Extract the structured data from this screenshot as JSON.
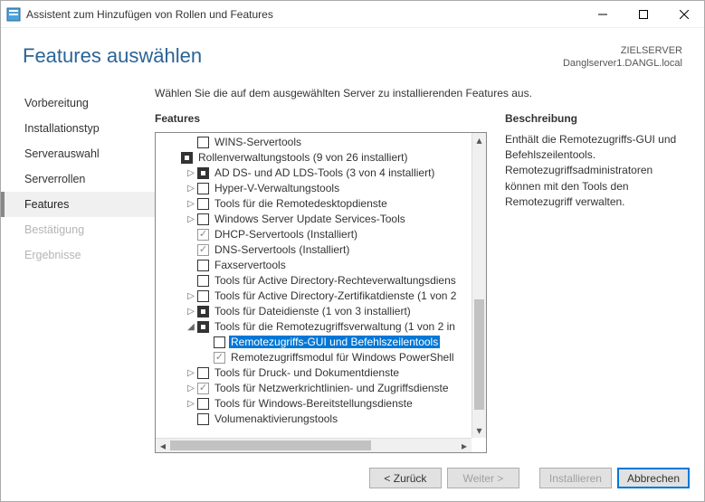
{
  "window": {
    "title": "Assistent zum Hinzufügen von Rollen und Features"
  },
  "header": {
    "title": "Features auswählen",
    "target_label": "ZIELSERVER",
    "target_value": "Danglserver1.DANGL.local"
  },
  "nav": [
    {
      "label": "Vorbereitung",
      "state": "done"
    },
    {
      "label": "Installationstyp",
      "state": "done"
    },
    {
      "label": "Serverauswahl",
      "state": "done"
    },
    {
      "label": "Serverrollen",
      "state": "done"
    },
    {
      "label": "Features",
      "state": "active"
    },
    {
      "label": "Bestätigung",
      "state": "disabled"
    },
    {
      "label": "Ergebnisse",
      "state": "disabled"
    }
  ],
  "instruction": "Wählen Sie die auf dem ausgewählten Server zu installierenden Features aus.",
  "columns": {
    "features": "Features",
    "description": "Beschreibung"
  },
  "tree": [
    {
      "indent": 1,
      "exp": "",
      "cb": "empty",
      "label": "WINS-Servertools",
      "sel": false
    },
    {
      "indent": 0,
      "exp": "",
      "cb": "tri",
      "label": "Rollenverwaltungstools (9 von 26 installiert)",
      "sel": false
    },
    {
      "indent": 1,
      "exp": "r",
      "cb": "tri",
      "label": "AD DS- und AD LDS-Tools (3 von 4 installiert)",
      "sel": false
    },
    {
      "indent": 1,
      "exp": "r",
      "cb": "empty",
      "label": "Hyper-V-Verwaltungstools",
      "sel": false
    },
    {
      "indent": 1,
      "exp": "r",
      "cb": "empty",
      "label": "Tools für die Remotedesktopdienste",
      "sel": false
    },
    {
      "indent": 1,
      "exp": "r",
      "cb": "empty",
      "label": "Windows Server Update Services-Tools",
      "sel": false
    },
    {
      "indent": 1,
      "exp": "",
      "cb": "chkdis",
      "label": "DHCP-Servertools (Installiert)",
      "sel": false
    },
    {
      "indent": 1,
      "exp": "",
      "cb": "chkdis",
      "label": "DNS-Servertools (Installiert)",
      "sel": false
    },
    {
      "indent": 1,
      "exp": "",
      "cb": "empty",
      "label": "Faxservertools",
      "sel": false
    },
    {
      "indent": 1,
      "exp": "",
      "cb": "empty",
      "label": "Tools für Active Directory-Rechteverwaltungsdiens",
      "sel": false
    },
    {
      "indent": 1,
      "exp": "r",
      "cb": "empty",
      "label": "Tools für Active Directory-Zertifikatdienste (1 von 2",
      "sel": false
    },
    {
      "indent": 1,
      "exp": "r",
      "cb": "tri",
      "label": "Tools für Dateidienste (1 von 3 installiert)",
      "sel": false
    },
    {
      "indent": 1,
      "exp": "d",
      "cb": "tri",
      "label": "Tools für die Remotezugriffsverwaltung (1 von 2 in",
      "sel": false
    },
    {
      "indent": 2,
      "exp": "",
      "cb": "empty",
      "label": "Remotezugriffs-GUI und Befehlszeilentools",
      "sel": true
    },
    {
      "indent": 2,
      "exp": "",
      "cb": "chkdis",
      "label": "Remotezugriffsmodul für Windows PowerShell",
      "sel": false
    },
    {
      "indent": 1,
      "exp": "r",
      "cb": "empty",
      "label": "Tools für Druck- und Dokumentdienste",
      "sel": false
    },
    {
      "indent": 1,
      "exp": "r",
      "cb": "chkdis",
      "label": "Tools für Netzwerkrichtlinien- und Zugriffsdienste",
      "sel": false
    },
    {
      "indent": 1,
      "exp": "r",
      "cb": "empty",
      "label": "Tools für Windows-Bereitstellungsdienste",
      "sel": false
    },
    {
      "indent": 1,
      "exp": "",
      "cb": "empty",
      "label": "Volumenaktivierungstools",
      "sel": false
    }
  ],
  "description": "Enthält die Remotezugriffs-GUI und Befehlszeilentools. Remotezugriffsadministratoren können mit den Tools den Remotezugriff verwalten.",
  "buttons": {
    "prev": "< Zurück",
    "next": "Weiter >",
    "install": "Installieren",
    "cancel": "Abbrechen"
  }
}
